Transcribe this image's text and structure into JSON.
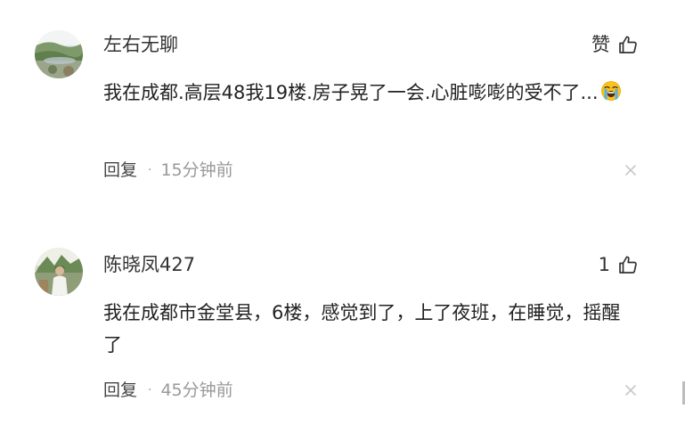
{
  "comments": [
    {
      "username": "左右无聊",
      "like_label": "赞",
      "content": "我在成都.高层48我19楼.房子晃了一会.心脏嘭嘭的受不了...",
      "emoji": "loudly-crying-face-emoji",
      "reply_label": "回复",
      "separator": "·",
      "time": "15分钟前"
    },
    {
      "username": "陈晓凤427",
      "like_label": "1",
      "content": "我在成都市金堂县，6楼，感觉到了，上了夜班，在睡觉，摇醒了",
      "reply_label": "回复",
      "separator": "·",
      "time": "45分钟前"
    }
  ],
  "icons": {
    "like": "thumbs-up-outline-icon",
    "close": "close-icon"
  },
  "colors": {
    "text": "#222222",
    "muted": "#999999",
    "icon": "#333333",
    "close": "#c8c8c8"
  }
}
